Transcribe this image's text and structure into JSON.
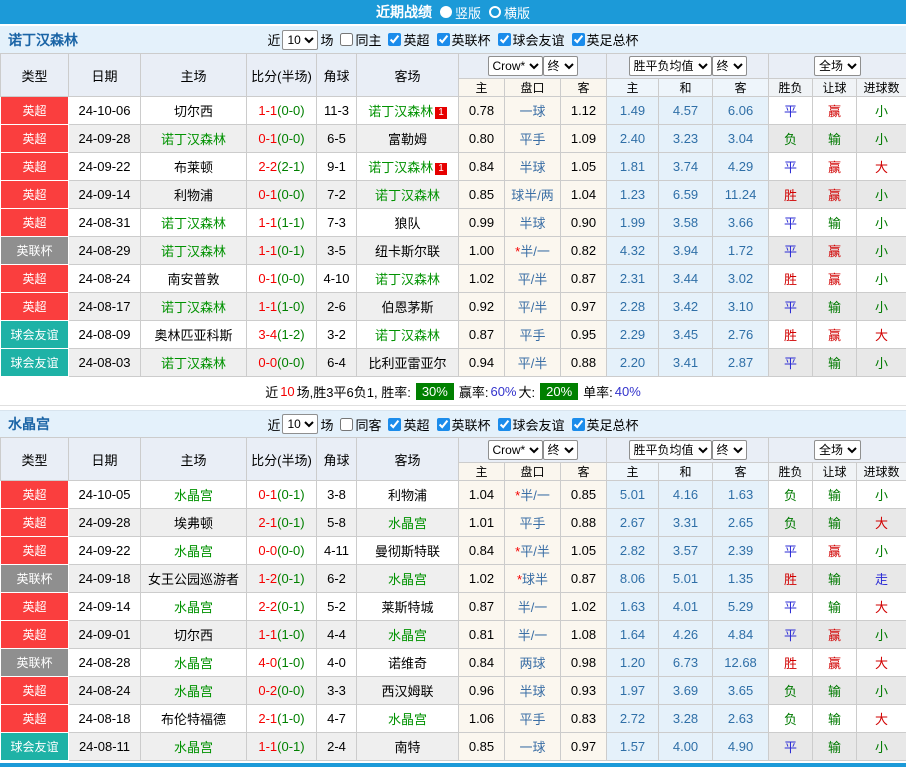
{
  "topbar": {
    "title": "近期战绩",
    "options": [
      {
        "label": "竖版",
        "selected": true
      },
      {
        "label": "横版",
        "selected": false
      }
    ]
  },
  "colors": {
    "accent": "#1c9ad8",
    "type_colors": {
      "英超": "#fa3e3e",
      "英联杯": "#8f8f8f",
      "球会友谊": "#1eb2a6"
    },
    "palette": {
      "red": "#d10000",
      "blue": "#2b2bd5",
      "green": "#007a00"
    },
    "outcome_color_map": {
      "胜": "red",
      "平": "blue",
      "负": "green",
      "赢": "red",
      "输": "green",
      "大": "red",
      "小": "green",
      "走": "blue"
    }
  },
  "table_header": {
    "type": "类型",
    "date": "日期",
    "home": "主场",
    "score": "比分(半场)",
    "corner": "角球",
    "away": "客场",
    "crow_select": "Crow*",
    "final_select": "终",
    "mean_select": "胜平负均值",
    "final_select2": "终",
    "scope_select": "全场",
    "sub_home": "主",
    "sub_handicap": "盘口",
    "sub_away": "客",
    "sub_mhome": "主",
    "sub_draw": "和",
    "sub_maway": "客",
    "sub_result": "胜负",
    "sub_spread": "让球",
    "sub_goals": "进球数"
  },
  "sections": [
    {
      "team": "诺丁汉森林",
      "filters": {
        "recent_label": "近",
        "recent_value": "10",
        "games_label": "场",
        "same_venue_label": "同主",
        "same_venue_checked": false,
        "competitions": [
          {
            "label": "英超",
            "checked": true
          },
          {
            "label": "英联杯",
            "checked": true
          },
          {
            "label": "球会友谊",
            "checked": true
          },
          {
            "label": "英足总杯",
            "checked": true
          }
        ]
      },
      "rows": [
        {
          "type": "英超",
          "date": "24-10-06",
          "home": "切尔西",
          "home_focus": false,
          "home_rc": "",
          "score": "1-1",
          "half": "(0-0)",
          "corner": "11-3",
          "away": "诺丁汉森林",
          "away_focus": true,
          "away_rc": "1",
          "crow_home": "0.78",
          "handicap_star": "",
          "handicap": "一球",
          "crow_away": "1.12",
          "mean_home": "1.49",
          "mean_draw": "4.57",
          "mean_away": "6.06",
          "result": "平",
          "spread": "赢",
          "goals": "小"
        },
        {
          "type": "英超",
          "date": "24-09-28",
          "home": "诺丁汉森林",
          "home_focus": true,
          "home_rc": "",
          "score": "0-1",
          "half": "(0-0)",
          "corner": "6-5",
          "away": "富勒姆",
          "away_focus": false,
          "away_rc": "",
          "crow_home": "0.80",
          "handicap_star": "",
          "handicap": "平手",
          "crow_away": "1.09",
          "mean_home": "2.40",
          "mean_draw": "3.23",
          "mean_away": "3.04",
          "result": "负",
          "spread": "输",
          "goals": "小"
        },
        {
          "type": "英超",
          "date": "24-09-22",
          "home": "布莱顿",
          "home_focus": false,
          "home_rc": "",
          "score": "2-2",
          "half": "(2-1)",
          "corner": "9-1",
          "away": "诺丁汉森林",
          "away_focus": true,
          "away_rc": "1",
          "crow_home": "0.84",
          "handicap_star": "",
          "handicap": "半球",
          "crow_away": "1.05",
          "mean_home": "1.81",
          "mean_draw": "3.74",
          "mean_away": "4.29",
          "result": "平",
          "spread": "赢",
          "goals": "大"
        },
        {
          "type": "英超",
          "date": "24-09-14",
          "home": "利物浦",
          "home_focus": false,
          "home_rc": "",
          "score": "0-1",
          "half": "(0-0)",
          "corner": "7-2",
          "away": "诺丁汉森林",
          "away_focus": true,
          "away_rc": "",
          "crow_home": "0.85",
          "handicap_star": "",
          "handicap": "球半/两",
          "crow_away": "1.04",
          "mean_home": "1.23",
          "mean_draw": "6.59",
          "mean_away": "11.24",
          "result": "胜",
          "spread": "赢",
          "goals": "小"
        },
        {
          "type": "英超",
          "date": "24-08-31",
          "home": "诺丁汉森林",
          "home_focus": true,
          "home_rc": "",
          "score": "1-1",
          "half": "(1-1)",
          "corner": "7-3",
          "away": "狼队",
          "away_focus": false,
          "away_rc": "",
          "crow_home": "0.99",
          "handicap_star": "",
          "handicap": "半球",
          "crow_away": "0.90",
          "mean_home": "1.99",
          "mean_draw": "3.58",
          "mean_away": "3.66",
          "result": "平",
          "spread": "输",
          "goals": "小"
        },
        {
          "type": "英联杯",
          "date": "24-08-29",
          "home": "诺丁汉森林",
          "home_focus": true,
          "home_rc": "",
          "score": "1-1",
          "half": "(0-1)",
          "corner": "3-5",
          "away": "纽卡斯尔联",
          "away_focus": false,
          "away_rc": "",
          "crow_home": "1.00",
          "handicap_star": "*",
          "handicap": "半/一",
          "crow_away": "0.82",
          "mean_home": "4.32",
          "mean_draw": "3.94",
          "mean_away": "1.72",
          "result": "平",
          "spread": "赢",
          "goals": "小"
        },
        {
          "type": "英超",
          "date": "24-08-24",
          "home": "南安普敦",
          "home_focus": false,
          "home_rc": "",
          "score": "0-1",
          "half": "(0-0)",
          "corner": "4-10",
          "away": "诺丁汉森林",
          "away_focus": true,
          "away_rc": "",
          "crow_home": "1.02",
          "handicap_star": "",
          "handicap": "平/半",
          "crow_away": "0.87",
          "mean_home": "2.31",
          "mean_draw": "3.44",
          "mean_away": "3.02",
          "result": "胜",
          "spread": "赢",
          "goals": "小"
        },
        {
          "type": "英超",
          "date": "24-08-17",
          "home": "诺丁汉森林",
          "home_focus": true,
          "home_rc": "",
          "score": "1-1",
          "half": "(1-0)",
          "corner": "2-6",
          "away": "伯恩茅斯",
          "away_focus": false,
          "away_rc": "",
          "crow_home": "0.92",
          "handicap_star": "",
          "handicap": "平/半",
          "crow_away": "0.97",
          "mean_home": "2.28",
          "mean_draw": "3.42",
          "mean_away": "3.10",
          "result": "平",
          "spread": "输",
          "goals": "小"
        },
        {
          "type": "球会友谊",
          "date": "24-08-09",
          "home": "奥林匹亚科斯",
          "home_focus": false,
          "home_rc": "",
          "score": "3-4",
          "half": "(1-2)",
          "corner": "3-2",
          "away": "诺丁汉森林",
          "away_focus": true,
          "away_rc": "",
          "crow_home": "0.87",
          "handicap_star": "",
          "handicap": "平手",
          "crow_away": "0.95",
          "mean_home": "2.29",
          "mean_draw": "3.45",
          "mean_away": "2.76",
          "result": "胜",
          "spread": "赢",
          "goals": "大"
        },
        {
          "type": "球会友谊",
          "date": "24-08-03",
          "home": "诺丁汉森林",
          "home_focus": true,
          "home_rc": "",
          "score": "0-0",
          "half": "(0-0)",
          "corner": "6-4",
          "away": "比利亚雷亚尔",
          "away_focus": false,
          "away_rc": "",
          "crow_home": "0.94",
          "handicap_star": "",
          "handicap": "平/半",
          "crow_away": "0.88",
          "mean_home": "2.20",
          "mean_draw": "3.41",
          "mean_away": "2.87",
          "result": "平",
          "spread": "输",
          "goals": "小"
        }
      ],
      "summary": {
        "lead": "近",
        "count": "10",
        "record": "场,胜3平6负1, 胜率:",
        "win_rate": "30%",
        "win_label": "赢率:",
        "win_value": "60%",
        "big_label": "大:",
        "big_value": "20%",
        "single_label": "单率:",
        "single_value": "40%"
      }
    },
    {
      "team": "水晶宫",
      "filters": {
        "recent_label": "近",
        "recent_value": "10",
        "games_label": "场",
        "same_venue_label": "同客",
        "same_venue_checked": false,
        "competitions": [
          {
            "label": "英超",
            "checked": true
          },
          {
            "label": "英联杯",
            "checked": true
          },
          {
            "label": "球会友谊",
            "checked": true
          },
          {
            "label": "英足总杯",
            "checked": true
          }
        ]
      },
      "rows": [
        {
          "type": "英超",
          "date": "24-10-05",
          "home": "水晶宫",
          "home_focus": true,
          "home_rc": "",
          "score": "0-1",
          "half": "(0-1)",
          "corner": "3-8",
          "away": "利物浦",
          "away_focus": false,
          "away_rc": "",
          "crow_home": "1.04",
          "handicap_star": "*",
          "handicap": "半/一",
          "crow_away": "0.85",
          "mean_home": "5.01",
          "mean_draw": "4.16",
          "mean_away": "1.63",
          "result": "负",
          "spread": "输",
          "goals": "小"
        },
        {
          "type": "英超",
          "date": "24-09-28",
          "home": "埃弗顿",
          "home_focus": false,
          "home_rc": "",
          "score": "2-1",
          "half": "(0-1)",
          "corner": "5-8",
          "away": "水晶宫",
          "away_focus": true,
          "away_rc": "",
          "crow_home": "1.01",
          "handicap_star": "",
          "handicap": "平手",
          "crow_away": "0.88",
          "mean_home": "2.67",
          "mean_draw": "3.31",
          "mean_away": "2.65",
          "result": "负",
          "spread": "输",
          "goals": "大"
        },
        {
          "type": "英超",
          "date": "24-09-22",
          "home": "水晶宫",
          "home_focus": true,
          "home_rc": "",
          "score": "0-0",
          "half": "(0-0)",
          "corner": "4-11",
          "away": "曼彻斯特联",
          "away_focus": false,
          "away_rc": "",
          "crow_home": "0.84",
          "handicap_star": "*",
          "handicap": "平/半",
          "crow_away": "1.05",
          "mean_home": "2.82",
          "mean_draw": "3.57",
          "mean_away": "2.39",
          "result": "平",
          "spread": "赢",
          "goals": "小"
        },
        {
          "type": "英联杯",
          "date": "24-09-18",
          "home": "女王公园巡游者",
          "home_focus": false,
          "home_rc": "",
          "score": "1-2",
          "half": "(0-1)",
          "corner": "6-2",
          "away": "水晶宫",
          "away_focus": true,
          "away_rc": "",
          "crow_home": "1.02",
          "handicap_star": "*",
          "handicap": "球半",
          "crow_away": "0.87",
          "mean_home": "8.06",
          "mean_draw": "5.01",
          "mean_away": "1.35",
          "result": "胜",
          "spread": "输",
          "goals": "走"
        },
        {
          "type": "英超",
          "date": "24-09-14",
          "home": "水晶宫",
          "home_focus": true,
          "home_rc": "",
          "score": "2-2",
          "half": "(0-1)",
          "corner": "5-2",
          "away": "莱斯特城",
          "away_focus": false,
          "away_rc": "",
          "crow_home": "0.87",
          "handicap_star": "",
          "handicap": "半/一",
          "crow_away": "1.02",
          "mean_home": "1.63",
          "mean_draw": "4.01",
          "mean_away": "5.29",
          "result": "平",
          "spread": "输",
          "goals": "大"
        },
        {
          "type": "英超",
          "date": "24-09-01",
          "home": "切尔西",
          "home_focus": false,
          "home_rc": "",
          "score": "1-1",
          "half": "(1-0)",
          "corner": "4-4",
          "away": "水晶宫",
          "away_focus": true,
          "away_rc": "",
          "crow_home": "0.81",
          "handicap_star": "",
          "handicap": "半/一",
          "crow_away": "1.08",
          "mean_home": "1.64",
          "mean_draw": "4.26",
          "mean_away": "4.84",
          "result": "平",
          "spread": "赢",
          "goals": "小"
        },
        {
          "type": "英联杯",
          "date": "24-08-28",
          "home": "水晶宫",
          "home_focus": true,
          "home_rc": "",
          "score": "4-0",
          "half": "(1-0)",
          "corner": "4-0",
          "away": "诺维奇",
          "away_focus": false,
          "away_rc": "",
          "crow_home": "0.84",
          "handicap_star": "",
          "handicap": "两球",
          "crow_away": "0.98",
          "mean_home": "1.20",
          "mean_draw": "6.73",
          "mean_away": "12.68",
          "result": "胜",
          "spread": "赢",
          "goals": "大"
        },
        {
          "type": "英超",
          "date": "24-08-24",
          "home": "水晶宫",
          "home_focus": true,
          "home_rc": "",
          "score": "0-2",
          "half": "(0-0)",
          "corner": "3-3",
          "away": "西汉姆联",
          "away_focus": false,
          "away_rc": "",
          "crow_home": "0.96",
          "handicap_star": "",
          "handicap": "半球",
          "crow_away": "0.93",
          "mean_home": "1.97",
          "mean_draw": "3.69",
          "mean_away": "3.65",
          "result": "负",
          "spread": "输",
          "goals": "小"
        },
        {
          "type": "英超",
          "date": "24-08-18",
          "home": "布伦特福德",
          "home_focus": false,
          "home_rc": "",
          "score": "2-1",
          "half": "(1-0)",
          "corner": "4-7",
          "away": "水晶宫",
          "away_focus": true,
          "away_rc": "",
          "crow_home": "1.06",
          "handicap_star": "",
          "handicap": "平手",
          "crow_away": "0.83",
          "mean_home": "2.72",
          "mean_draw": "3.28",
          "mean_away": "2.63",
          "result": "负",
          "spread": "输",
          "goals": "大"
        },
        {
          "type": "球会友谊",
          "date": "24-08-11",
          "home": "水晶宫",
          "home_focus": true,
          "home_rc": "",
          "score": "1-1",
          "half": "(0-1)",
          "corner": "2-4",
          "away": "南特",
          "away_focus": false,
          "away_rc": "",
          "crow_home": "0.85",
          "handicap_star": "",
          "handicap": "一球",
          "crow_away": "0.97",
          "mean_home": "1.57",
          "mean_draw": "4.00",
          "mean_away": "4.90",
          "result": "平",
          "spread": "输",
          "goals": "小"
        }
      ],
      "summary": null
    }
  ]
}
